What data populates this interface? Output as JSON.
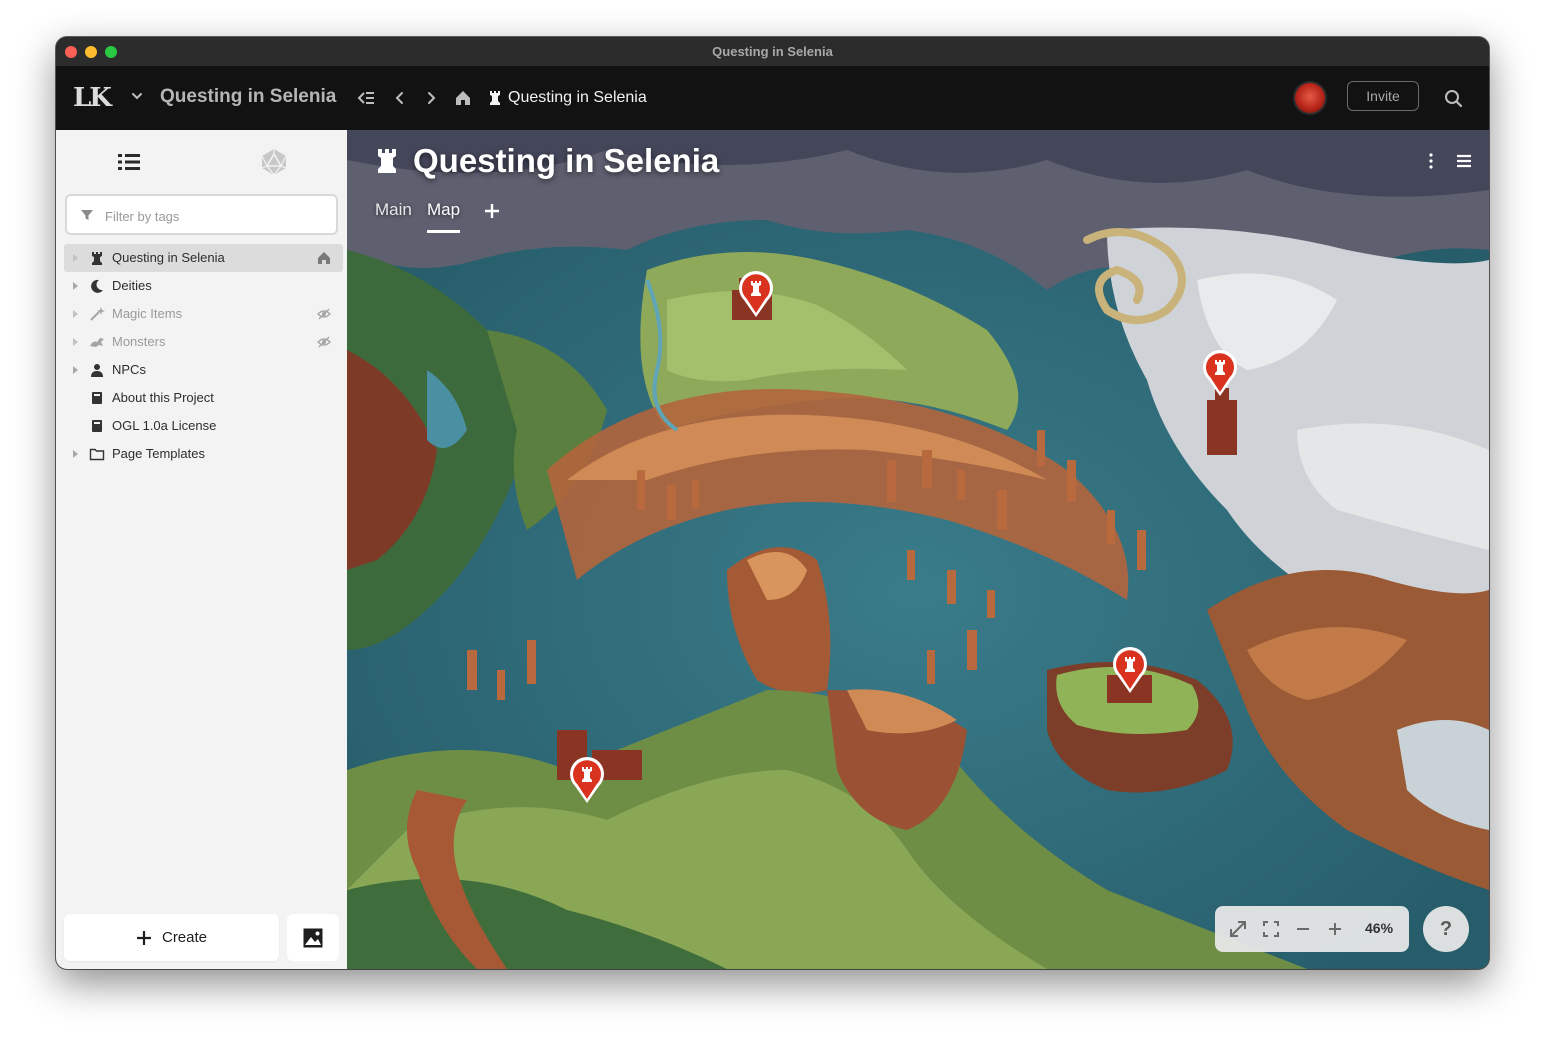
{
  "window": {
    "title": "Questing in Selenia"
  },
  "appbar": {
    "logo_text": "LK",
    "project_title": "Questing in Selenia",
    "breadcrumb": "Questing in Selenia",
    "invite_label": "Invite"
  },
  "sidebar": {
    "filter_placeholder": "Filter by tags",
    "items": [
      {
        "label": "Questing in Selenia",
        "icon": "rook-icon",
        "selected": true,
        "muted": false,
        "end_icon": "home-icon"
      },
      {
        "label": "Deities",
        "icon": "moon-icon",
        "selected": false,
        "muted": false
      },
      {
        "label": "Magic Items",
        "icon": "sparkle-wand-icon",
        "selected": false,
        "muted": true,
        "end_icon": "eye-slash-icon"
      },
      {
        "label": "Monsters",
        "icon": "dragon-icon",
        "selected": false,
        "muted": true,
        "end_icon": "eye-slash-icon"
      },
      {
        "label": "NPCs",
        "icon": "person-icon",
        "selected": false,
        "muted": false
      },
      {
        "label": "About this Project",
        "icon": "book-icon",
        "selected": false,
        "muted": false
      },
      {
        "label": "OGL 1.0a License",
        "icon": "book-icon",
        "selected": false,
        "muted": false
      },
      {
        "label": "Page Templates",
        "icon": "folder-icon",
        "selected": false,
        "muted": false
      }
    ],
    "create_label": "Create"
  },
  "main": {
    "page_title": "Questing in Selenia",
    "tabs": [
      {
        "label": "Main",
        "active": false
      },
      {
        "label": "Map",
        "active": true
      }
    ],
    "zoom_level": "46%",
    "help_label": "?",
    "pins": [
      "castle-pin",
      "castle-pin",
      "castle-pin",
      "castle-pin"
    ]
  },
  "colors": {
    "accent_pin": "#d9331f",
    "appbar_bg": "#121212",
    "sidebar_bg": "#f3f3f3",
    "water": "#2f6c7c"
  }
}
